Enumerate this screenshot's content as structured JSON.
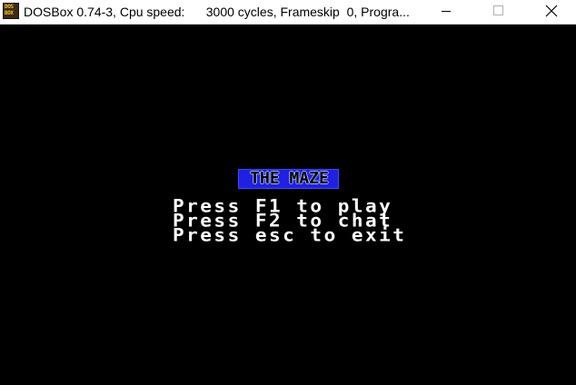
{
  "window": {
    "title": "DOSBox 0.74-3, Cpu speed:      3000 cycles, Frameskip  0, Progra...",
    "icon_text_top": "DOS",
    "icon_text_bottom": "BOX",
    "icon": "dosbox-app-icon",
    "controls": {
      "minimize": "minimize-icon",
      "maximize": "maximize-icon",
      "close": "close-icon"
    }
  },
  "game": {
    "title": "THE MAZE",
    "menu": [
      "Press F1 to play",
      "Press F2 to chat",
      "Press esc to exit"
    ]
  },
  "colors": {
    "screen_bg": "#000000",
    "title_fill": "#2020e0",
    "menu_text": "#ffffff"
  }
}
